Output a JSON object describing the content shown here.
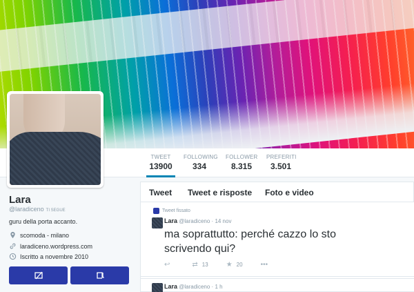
{
  "profile": {
    "name": "Lara",
    "handle": "@laradiceno",
    "follows_you": "TI SEGUE",
    "bio": "guru della porta accanto.",
    "location": "scomoda - milano",
    "website": "laradiceno.wordpress.com",
    "joined": "Iscritto a novembre 2010"
  },
  "stats": [
    {
      "label": "TWEET",
      "value": "13900"
    },
    {
      "label": "FOLLOWING",
      "value": "334"
    },
    {
      "label": "FOLLOWER",
      "value": "8.315"
    },
    {
      "label": "PREFERITI",
      "value": "3.501"
    }
  ],
  "tabs": [
    "Tweet",
    "Tweet e risposte",
    "Foto e video"
  ],
  "tweets": [
    {
      "context": "Tweet fissato",
      "name": "Lara",
      "handle": "@laradiceno",
      "time": "14 nov",
      "text": "ma soprattutto: perché cazzo lo sto scrivendo qui?",
      "retweets": "13",
      "favorites": "20"
    },
    {
      "name": "Lara",
      "handle": "@laradiceno",
      "time": "1 h"
    }
  ],
  "icons": {
    "location": "location-pin-icon",
    "website": "link-icon",
    "joined": "clock-icon",
    "message": "message-icon",
    "retweet": "retweet-icon",
    "reply": "reply-icon",
    "favorite": "star-icon",
    "more": "more-icon",
    "pinned": "pin-icon"
  },
  "colors": {
    "accent": "#2a3aa8",
    "link": "#0084b4",
    "muted": "#8899a6",
    "text": "#292f33"
  }
}
